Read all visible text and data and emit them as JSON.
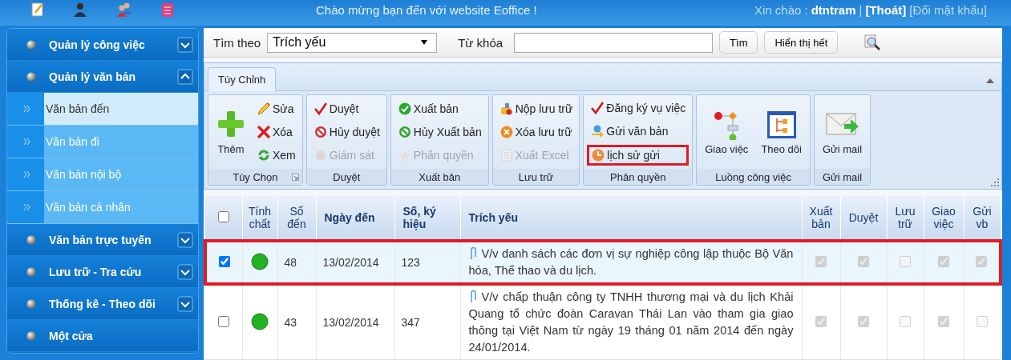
{
  "header": {
    "welcome": "Chào mừng bạn đến với website Eoffice !",
    "greeting": "Xin chào :",
    "user": "dtntram",
    "separator": "|",
    "logout": "[Thoát]",
    "change_password": "[Đổi mật khẩu]"
  },
  "sidebar": {
    "items": [
      {
        "label": "Quản lý công việc",
        "kind": "collapsible",
        "expanded": false
      },
      {
        "label": "Quản lý văn bản",
        "kind": "collapsible",
        "expanded": true,
        "children": [
          {
            "label": "Văn bản đến",
            "selected": true
          },
          {
            "label": "Văn bản đi",
            "selected": false
          },
          {
            "label": "Văn bản nội bộ",
            "selected": false
          },
          {
            "label": "Văn bản cá nhân",
            "selected": false
          }
        ]
      },
      {
        "label": "Văn bản trực tuyến",
        "kind": "collapsible",
        "expanded": false
      },
      {
        "label": "Lưu trữ - Tra cứu",
        "kind": "collapsible",
        "expanded": false
      },
      {
        "label": "Thống kê - Theo dõi",
        "kind": "collapsible",
        "expanded": false
      },
      {
        "label": "Một cửa",
        "kind": "link"
      }
    ]
  },
  "search": {
    "label": "Tìm theo",
    "select": "Trích yếu",
    "keyword_label": "Từ khóa",
    "buttons": [
      "Tìm",
      "Hiển thị hết"
    ]
  },
  "ribbon": {
    "tabs": [
      {
        "label": "Tùy Chỉnh",
        "selected": true
      }
    ],
    "groups": [
      {
        "title": "Tùy Chọn",
        "launcher": true,
        "items": [
          {
            "label": "Thêm",
            "kind": "large",
            "disabled": false,
            "highlighted": false
          },
          {
            "label": "Sửa",
            "kind": "small",
            "disabled": false,
            "highlighted": false
          },
          {
            "label": "Xóa",
            "kind": "small",
            "disabled": false,
            "highlighted": false
          },
          {
            "label": "Xem",
            "kind": "small",
            "disabled": false,
            "highlighted": false
          }
        ]
      },
      {
        "title": "Duyệt",
        "launcher": false,
        "items": [
          {
            "label": "Duyệt",
            "kind": "small",
            "disabled": false,
            "highlighted": false
          },
          {
            "label": "Hủy duyệt",
            "kind": "small",
            "disabled": false,
            "highlighted": false
          },
          {
            "label": "Giám sát",
            "kind": "small",
            "disabled": true,
            "highlighted": false
          }
        ]
      },
      {
        "title": "Xuất bản",
        "launcher": false,
        "items": [
          {
            "label": "Xuất bản",
            "kind": "small",
            "disabled": false,
            "highlighted": false
          },
          {
            "label": "Hủy Xuất bản",
            "kind": "small",
            "disabled": false,
            "highlighted": false
          },
          {
            "label": "Phân quyền",
            "kind": "small",
            "disabled": true,
            "highlighted": false
          }
        ]
      },
      {
        "title": "Lưu trữ",
        "launcher": false,
        "items": [
          {
            "label": "Nộp lưu trữ",
            "kind": "small",
            "disabled": false,
            "highlighted": false
          },
          {
            "label": "Xóa lưu trữ",
            "kind": "small",
            "disabled": false,
            "highlighted": false
          },
          {
            "label": "Xuất Excel",
            "kind": "small",
            "disabled": true,
            "highlighted": false
          }
        ]
      },
      {
        "title": "Phân quyền",
        "launcher": false,
        "items": [
          {
            "label": "Đăng ký vụ việc",
            "kind": "small",
            "disabled": false,
            "highlighted": false
          },
          {
            "label": "Gửi văn bản",
            "kind": "small",
            "disabled": false,
            "highlighted": false
          },
          {
            "label": "lịch sử gửi",
            "kind": "small",
            "disabled": false,
            "highlighted": true
          }
        ]
      },
      {
        "title": "Luồng công việc",
        "launcher": false,
        "items": [
          {
            "label": "Giao việc",
            "kind": "large",
            "disabled": false,
            "highlighted": false
          },
          {
            "label": "Theo dõi",
            "kind": "large",
            "disabled": false,
            "highlighted": false
          }
        ]
      },
      {
        "title": "Gửi mail",
        "launcher": false,
        "items": [
          {
            "label": "Gửi mail",
            "kind": "large",
            "disabled": false,
            "highlighted": false
          }
        ]
      }
    ]
  },
  "table": {
    "select_all": false,
    "columns": [
      "Tính chất",
      "Số đến",
      "Ngày đến",
      "Số, ký hiệu",
      "Trích yếu",
      "Xuất bản",
      "Duyệt",
      "Lưu trữ",
      "Giao việc",
      "Gửi vb"
    ],
    "rows": [
      {
        "checked": true,
        "selected": true,
        "color": "#22b122",
        "so_den": "48",
        "ngay_den": "13/02/2014",
        "so_ky_hieu": "123",
        "trich_yeu": "V/v danh sách các đơn vị sự nghiệp công lập thuộc Bộ Văn hóa, Thể thao và du lịch.",
        "flags": [
          {
            "checked": true
          },
          {
            "checked": true
          },
          {
            "checked": false
          },
          {
            "checked": true
          },
          {
            "checked": true
          }
        ]
      },
      {
        "checked": false,
        "selected": false,
        "color": "#22b122",
        "so_den": "43",
        "ngay_den": "13/02/2014",
        "so_ky_hieu": "347",
        "trich_yeu": "V/v chấp thuận công ty TNHH thương mại và du lịch Khải Quang tổ chức đoàn Caravan Thái Lan vào tham gia giao thông tại Việt Nam từ ngày 19 tháng 01 năm 2014 đến ngày 24/01/2014.",
        "flags": [
          {
            "checked": true
          },
          {
            "checked": true
          },
          {
            "checked": false
          },
          {
            "checked": true
          },
          {
            "checked": false
          }
        ]
      }
    ]
  }
}
